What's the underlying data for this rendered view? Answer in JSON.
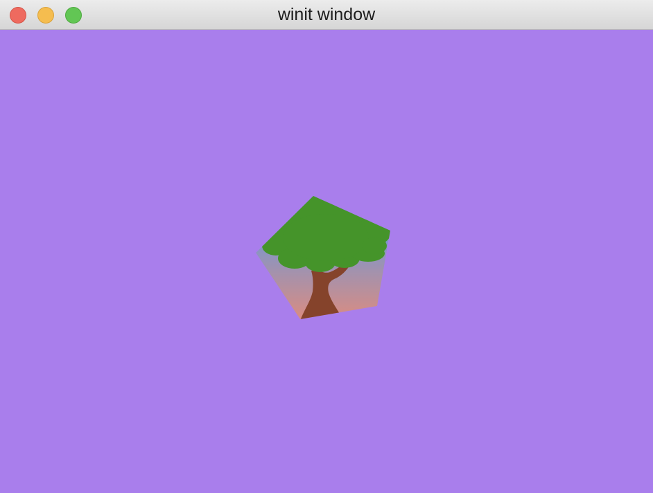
{
  "window": {
    "title": "winit window",
    "buttons": [
      {
        "name": "close",
        "color": "#ee6a5f",
        "border": "#d65548"
      },
      {
        "name": "minimize",
        "color": "#f5bd4f",
        "border": "#d9a23a"
      },
      {
        "name": "zoom",
        "color": "#62c654",
        "border": "#4ea93f"
      }
    ]
  },
  "canvas": {
    "background_color": "#a97eec",
    "shape": "pentagon",
    "texture": "tree",
    "texture_colors": {
      "sky_top": "#4d9bf2",
      "sky_bottom": "#d98c82",
      "foliage": "#45942a",
      "trunk": "#85432b"
    }
  }
}
